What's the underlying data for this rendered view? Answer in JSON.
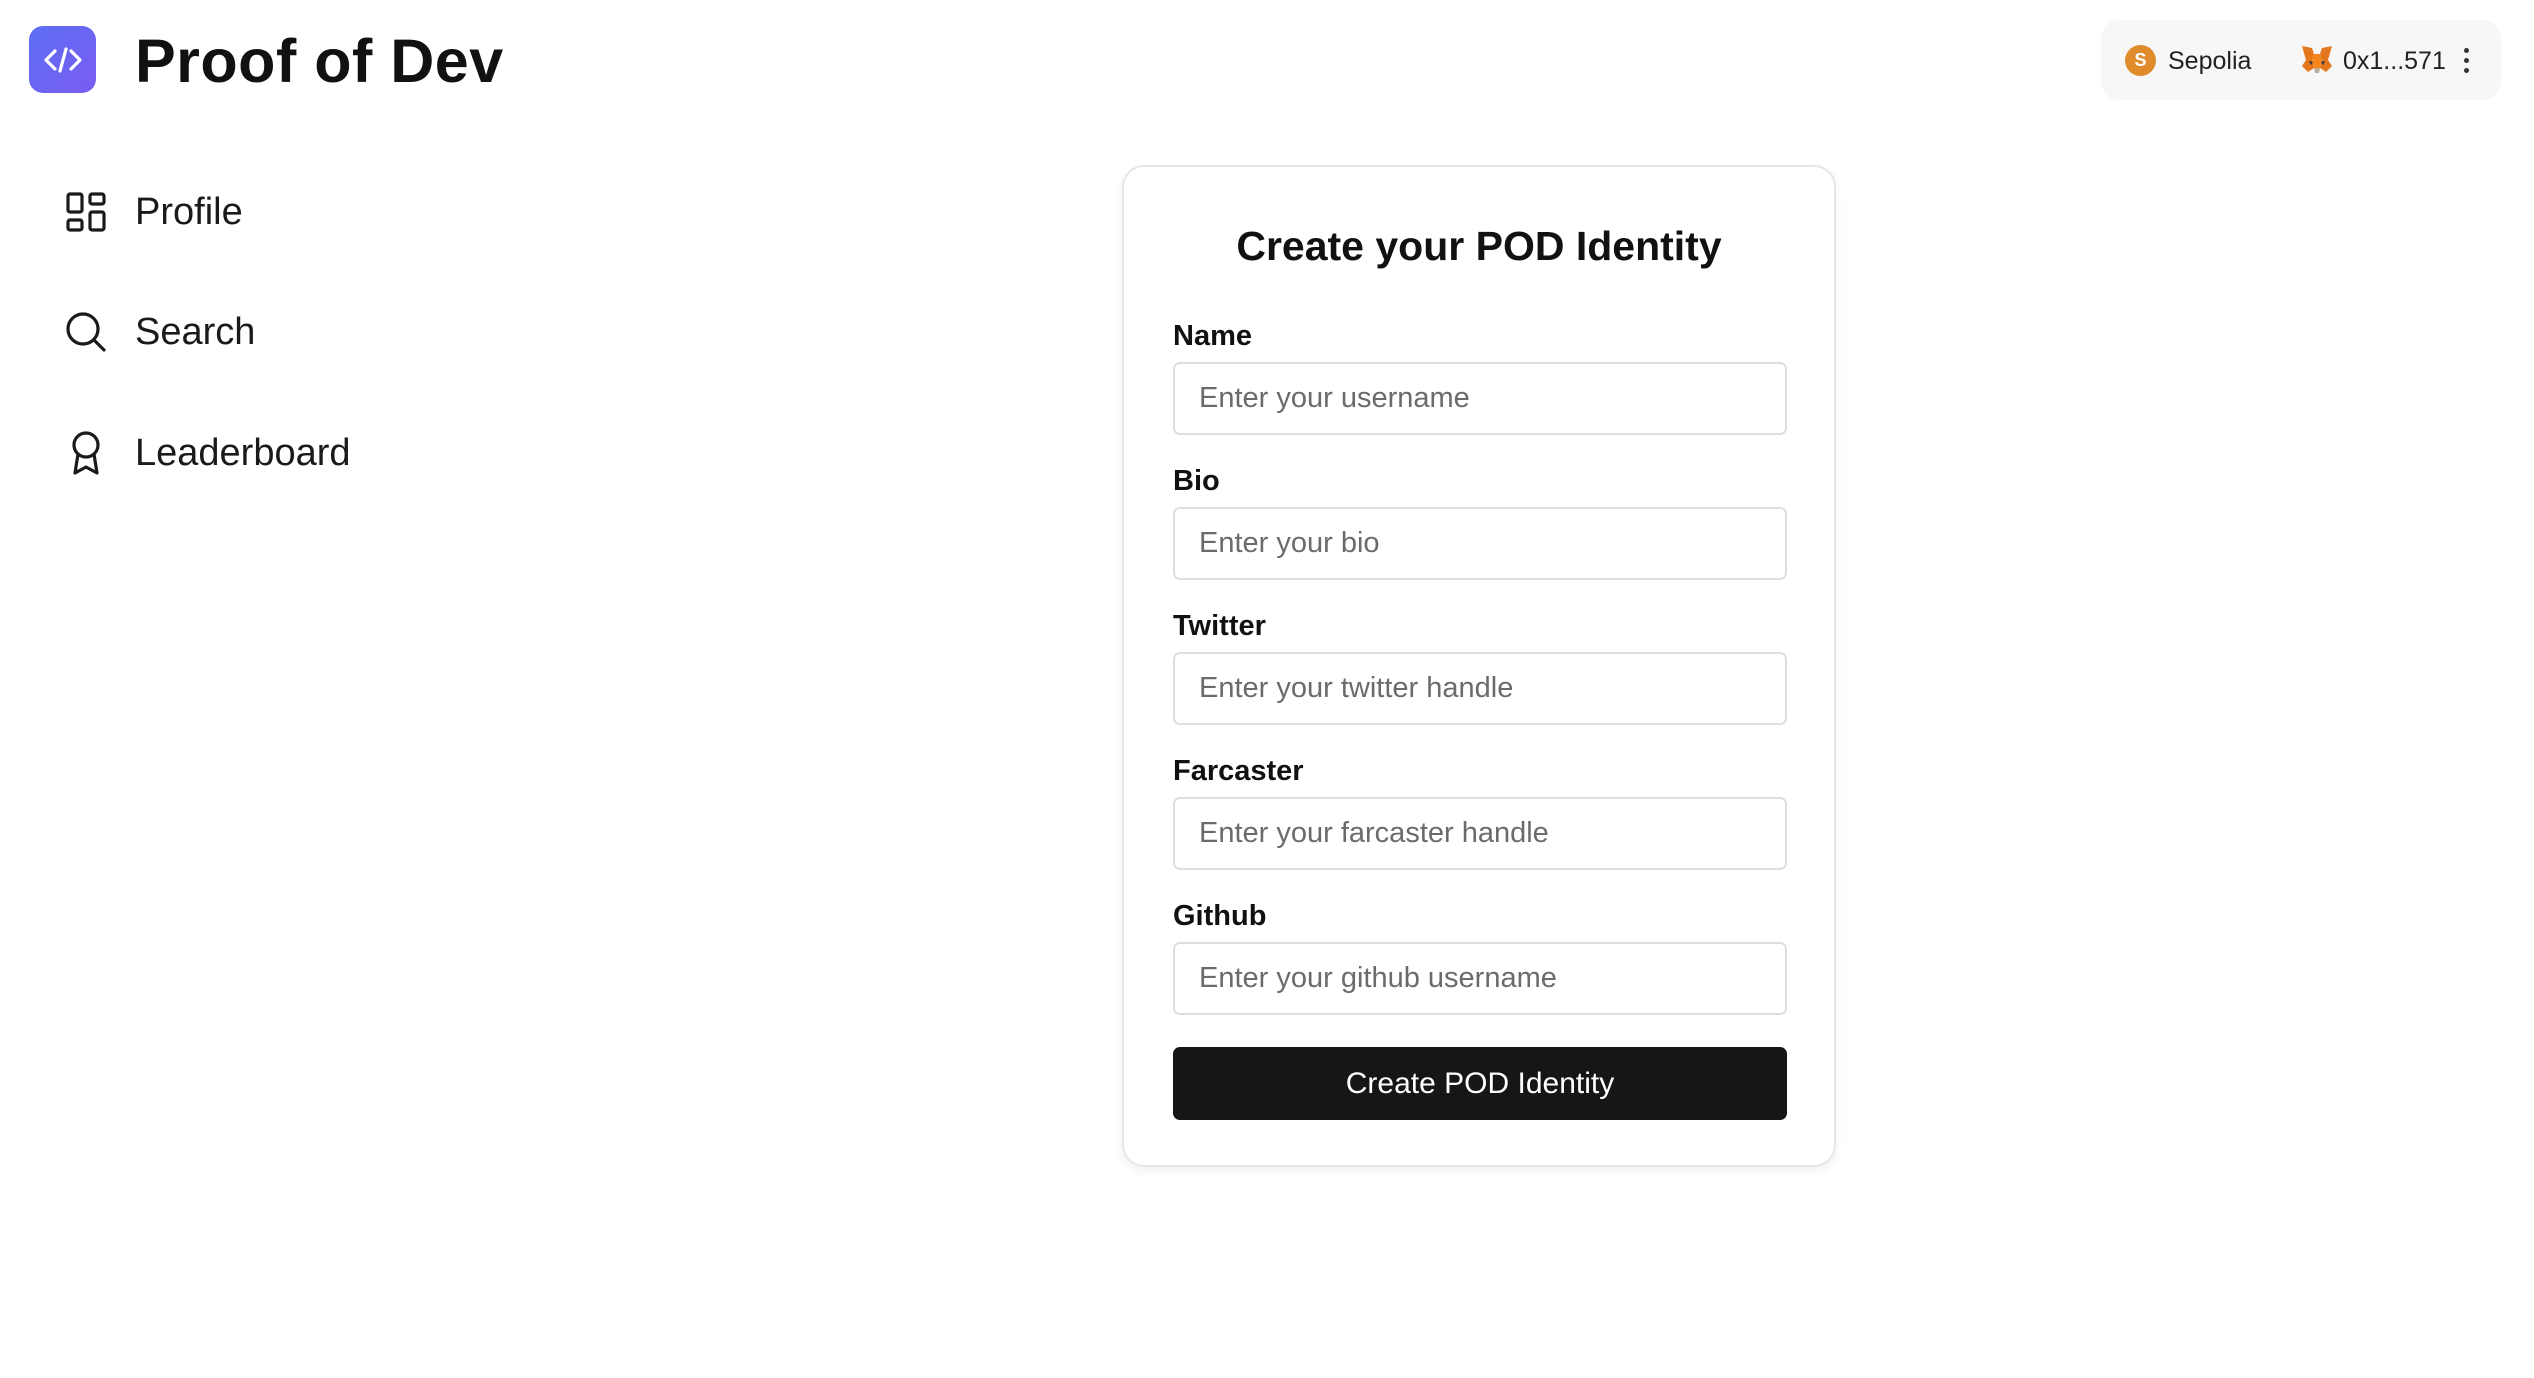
{
  "app": {
    "title": "Proof of Dev"
  },
  "wallet": {
    "network_initial": "S",
    "network": "Sepolia",
    "address": "0x1...571"
  },
  "sidebar": {
    "items": [
      {
        "label": "Profile",
        "icon": "grid-icon"
      },
      {
        "label": "Search",
        "icon": "search-icon"
      },
      {
        "label": "Leaderboard",
        "icon": "award-icon"
      }
    ]
  },
  "form": {
    "title": "Create your POD Identity",
    "fields": [
      {
        "label": "Name",
        "placeholder": "Enter your username",
        "value": ""
      },
      {
        "label": "Bio",
        "placeholder": "Enter your bio",
        "value": ""
      },
      {
        "label": "Twitter",
        "placeholder": "Enter your twitter handle",
        "value": ""
      },
      {
        "label": "Farcaster",
        "placeholder": "Enter your farcaster handle",
        "value": ""
      },
      {
        "label": "Github",
        "placeholder": "Enter your github username",
        "value": ""
      }
    ],
    "submit_label": "Create POD Identity"
  },
  "colors": {
    "brand": "#6366f1",
    "button": "#161616",
    "network_badge": "#e08c2c"
  }
}
